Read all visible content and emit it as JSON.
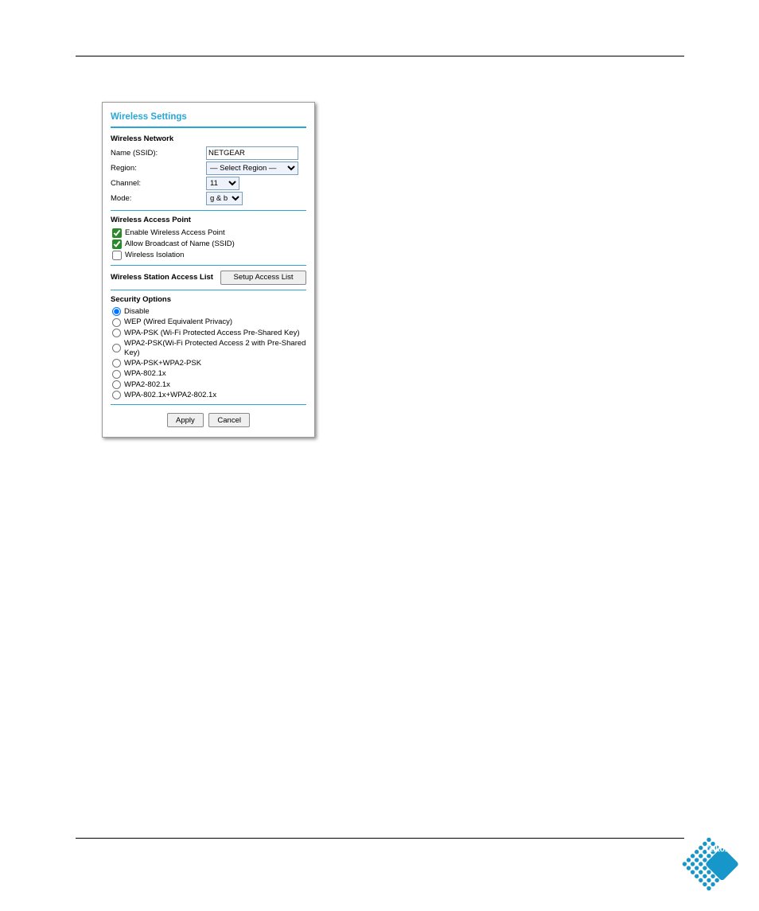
{
  "title": "Wireless Settings",
  "network": {
    "heading": "Wireless Network",
    "name_label": "Name (SSID):",
    "name_value": "NETGEAR",
    "region_label": "Region:",
    "region_value": "— Select Region —",
    "channel_label": "Channel:",
    "channel_value": "11",
    "mode_label": "Mode:",
    "mode_value": "g & b"
  },
  "ap": {
    "heading": "Wireless Access Point",
    "enable_label": "Enable Wireless Access Point",
    "enable_checked": true,
    "broadcast_label": "Allow Broadcast of Name (SSID)",
    "broadcast_checked": true,
    "isolation_label": "Wireless Isolation",
    "isolation_checked": false
  },
  "access_list": {
    "heading": "Wireless Station Access List",
    "button_label": "Setup Access List"
  },
  "security": {
    "heading": "Security Options",
    "options": [
      "Disable",
      "WEP (Wired Equivalent Privacy)",
      "WPA-PSK (Wi-Fi Protected Access Pre-Shared Key)",
      "WPA2-PSK(Wi-Fi Protected Access 2 with Pre-Shared Key)",
      "WPA-PSK+WPA2-PSK",
      "WPA-802.1x",
      "WPA2-802.1x",
      "WPA-802.1x+WPA2-802.1x"
    ],
    "selected_index": 0
  },
  "buttons": {
    "apply": "Apply",
    "cancel": "Cancel"
  },
  "logo_text": "Telkom"
}
